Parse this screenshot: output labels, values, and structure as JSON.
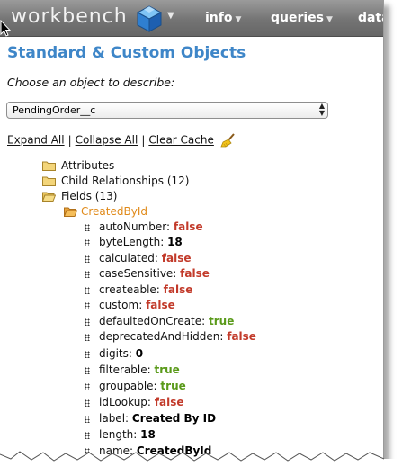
{
  "navbar": {
    "brand": "workbench",
    "menus": [
      {
        "label": "info"
      },
      {
        "label": "queries"
      },
      {
        "label": "data"
      }
    ]
  },
  "page": {
    "title": "Standard & Custom Objects",
    "prompt": "Choose an object to describe:",
    "selected_object": "PendingOrder__c"
  },
  "links": {
    "expand_all": "Expand All",
    "collapse_all": "Collapse All",
    "clear_cache": "Clear Cache",
    "separator": "|"
  },
  "tree": {
    "attributes": "Attributes",
    "child_relationships": "Child Relationships (12)",
    "fields": "Fields (13)",
    "field_open": "CreatedById",
    "properties": [
      {
        "name": "autoNumber:",
        "value": "false",
        "kind": "false"
      },
      {
        "name": "byteLength:",
        "value": "18",
        "kind": "plain"
      },
      {
        "name": "calculated:",
        "value": "false",
        "kind": "false"
      },
      {
        "name": "caseSensitive:",
        "value": "false",
        "kind": "false"
      },
      {
        "name": "createable:",
        "value": "false",
        "kind": "false"
      },
      {
        "name": "custom:",
        "value": "false",
        "kind": "false"
      },
      {
        "name": "defaultedOnCreate:",
        "value": "true",
        "kind": "true"
      },
      {
        "name": "deprecatedAndHidden:",
        "value": "false",
        "kind": "false"
      },
      {
        "name": "digits:",
        "value": "0",
        "kind": "plain"
      },
      {
        "name": "filterable:",
        "value": "true",
        "kind": "true"
      },
      {
        "name": "groupable:",
        "value": "true",
        "kind": "true"
      },
      {
        "name": "idLookup:",
        "value": "false",
        "kind": "false"
      },
      {
        "name": "label:",
        "value": "Created By ID",
        "kind": "plain"
      },
      {
        "name": "length:",
        "value": "18",
        "kind": "plain"
      },
      {
        "name": "name:",
        "value": "CreatedById",
        "kind": "plain"
      }
    ]
  },
  "colors": {
    "title": "#3e86c8",
    "false": "#c23a2a",
    "true": "#5a9a1a",
    "link_orange": "#e08a1a",
    "navbar": "#747474"
  }
}
